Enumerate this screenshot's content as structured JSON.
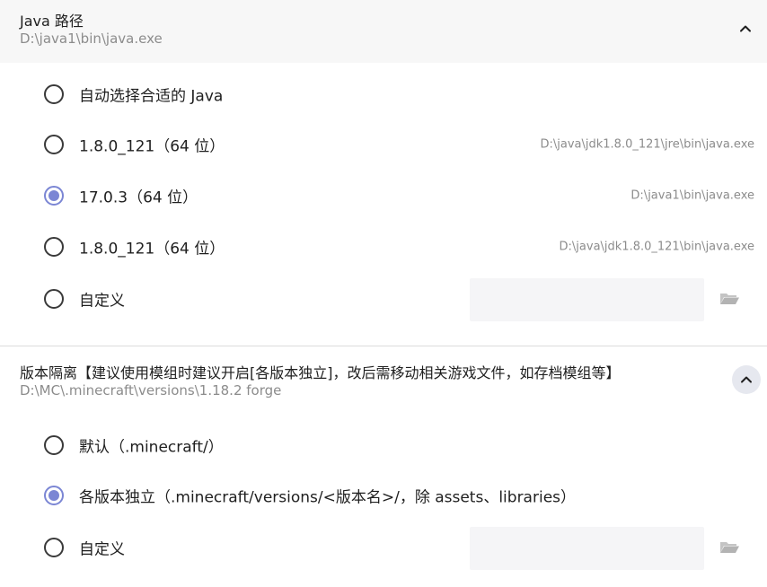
{
  "java_section": {
    "title": "Java 路径",
    "current": "D:\\java1\\bin\\java.exe",
    "options": [
      {
        "label": "自动选择合适的 Java",
        "path": "",
        "checked": false
      },
      {
        "label": "1.8.0_121（64 位）",
        "path": "D:\\java\\jdk1.8.0_121\\jre\\bin\\java.exe",
        "checked": false
      },
      {
        "label": "17.0.3（64 位）",
        "path": "D:\\java1\\bin\\java.exe",
        "checked": true
      },
      {
        "label": "1.8.0_121（64 位）",
        "path": "D:\\java\\jdk1.8.0_121\\bin\\java.exe",
        "checked": false
      },
      {
        "label": "自定义",
        "path": "",
        "checked": false
      }
    ],
    "custom_value": ""
  },
  "isolation_section": {
    "title": "版本隔离【建议使用模组时建议开启[各版本独立]，改后需移动相关游戏文件，如存档模组等】",
    "current": "D:\\MC\\.minecraft\\versions\\1.18.2 forge",
    "options": [
      {
        "label": "默认（.minecraft/）",
        "checked": false
      },
      {
        "label": "各版本独立（.minecraft/versions/<版本名>/，除 assets、libraries）",
        "checked": true
      },
      {
        "label": "自定义",
        "checked": false
      }
    ],
    "custom_value": ""
  },
  "colors": {
    "accent": "#7b86d4",
    "header_bg": "#f7f7f7",
    "secondary_text": "#8c8c8c",
    "input_bg": "#f5f5f7"
  },
  "icons": {
    "collapse": "chevron-up-icon",
    "folder": "folder-open-icon"
  }
}
